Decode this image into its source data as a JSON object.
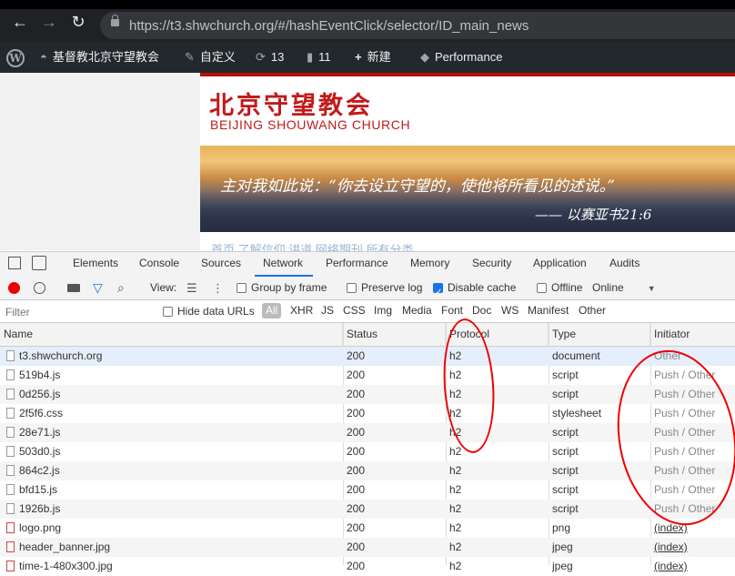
{
  "browser": {
    "url": "https://t3.shwchurch.org/#/hashEventClick/selector/ID_main_news"
  },
  "wp_admin_bar": {
    "site_name": "基督教北京守望教会",
    "customize": "自定义",
    "updates_count": "13",
    "comments_count": "11",
    "new_label": "新建",
    "performance": "Performance"
  },
  "page": {
    "title_cn": "北京守望教会",
    "title_en": "BEIJING SHOUWANG CHURCH",
    "banner_quote": "主对我如此说：“你去设立守望的，使他将所看见的述说。”",
    "banner_ref": "—— 以赛亚书21:6",
    "nav_partial": "首页   了解信仰   讲道   网络期刊   所有分类"
  },
  "devtools": {
    "tabs": [
      "Elements",
      "Console",
      "Sources",
      "Network",
      "Performance",
      "Memory",
      "Security",
      "Application",
      "Audits"
    ],
    "active_tab": "Network",
    "toolbar": {
      "view_label": "View:",
      "group_by_frame": "Group by frame",
      "preserve_log": "Preserve log",
      "disable_cache": "Disable cache",
      "offline": "Offline",
      "throttle": "Online"
    },
    "filter": {
      "placeholder": "Filter",
      "hide_data_urls": "Hide data URLs",
      "types": [
        "All",
        "XHR",
        "JS",
        "CSS",
        "Img",
        "Media",
        "Font",
        "Doc",
        "WS",
        "Manifest",
        "Other"
      ]
    },
    "columns": [
      "Name",
      "Status",
      "Protocol",
      "Type",
      "Initiator"
    ],
    "rows": [
      {
        "name": "t3.shwchurch.org",
        "status": "200",
        "protocol": "h2",
        "type": "document",
        "initiator": "Other"
      },
      {
        "name": "519b4.js",
        "status": "200",
        "protocol": "h2",
        "type": "script",
        "initiator": "Push / Other"
      },
      {
        "name": "0d256.js",
        "status": "200",
        "protocol": "h2",
        "type": "script",
        "initiator": "Push / Other"
      },
      {
        "name": "2f5f6.css",
        "status": "200",
        "protocol": "h2",
        "type": "stylesheet",
        "initiator": "Push / Other"
      },
      {
        "name": "28e71.js",
        "status": "200",
        "protocol": "h2",
        "type": "script",
        "initiator": "Push / Other"
      },
      {
        "name": "503d0.js",
        "status": "200",
        "protocol": "h2",
        "type": "script",
        "initiator": "Push / Other"
      },
      {
        "name": "864c2.js",
        "status": "200",
        "protocol": "h2",
        "type": "script",
        "initiator": "Push / Other"
      },
      {
        "name": "bfd15.js",
        "status": "200",
        "protocol": "h2",
        "type": "script",
        "initiator": "Push / Other"
      },
      {
        "name": "1926b.js",
        "status": "200",
        "protocol": "h2",
        "type": "script",
        "initiator": "Push / Other"
      },
      {
        "name": "logo.png",
        "status": "200",
        "protocol": "h2",
        "type": "png",
        "initiator": "(index)"
      },
      {
        "name": "header_banner.jpg",
        "status": "200",
        "protocol": "h2",
        "type": "jpeg",
        "initiator": "(index)"
      },
      {
        "name": "time-1-480x300.jpg",
        "status": "200",
        "protocol": "h2",
        "type": "jpeg",
        "initiator": "(index)"
      }
    ]
  }
}
